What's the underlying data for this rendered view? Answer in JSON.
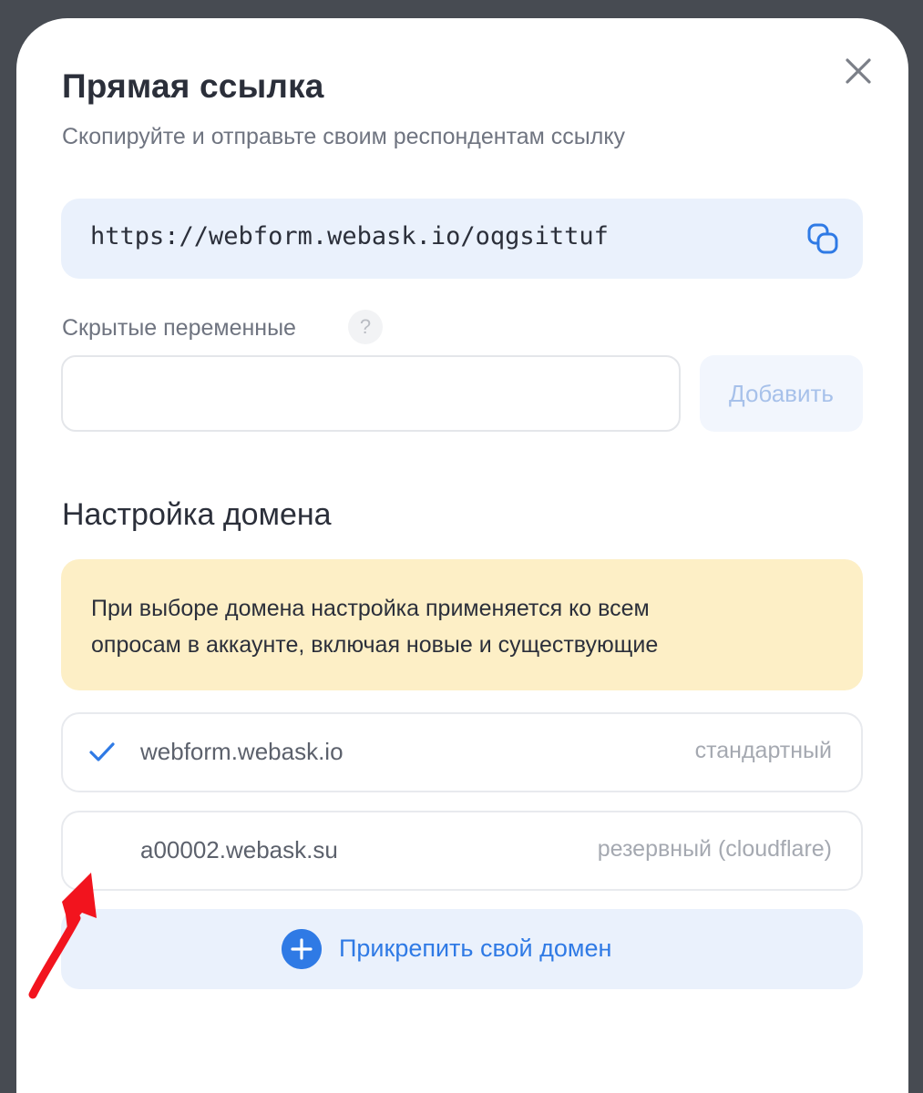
{
  "modal": {
    "title": "Прямая ссылка",
    "subtitle": "Скопируйте и отправьте своим респондентам ссылку"
  },
  "link": {
    "url": "https://webform.webask.io/oqgsittuf"
  },
  "hidden_variables": {
    "label": "Скрытые переменные",
    "help": "?",
    "input_value": "",
    "add_label": "Добавить"
  },
  "domain_settings": {
    "title": "Настройка домена",
    "warning_line1": "При выборе домена настройка применяется ко всем",
    "warning_line2": "опросам в аккаунте, включая новые и существующие",
    "domains": [
      {
        "name": "webform.webask.io",
        "type": "стандартный",
        "selected": true
      },
      {
        "name": "a00002.webask.su",
        "type": "резервный (cloudflare)",
        "selected": false
      }
    ],
    "attach_label": "Прикрепить свой домен"
  },
  "colors": {
    "accent": "#2f7ae5",
    "warning_bg": "#fdefc6",
    "annotation_arrow": "#f2141e"
  }
}
